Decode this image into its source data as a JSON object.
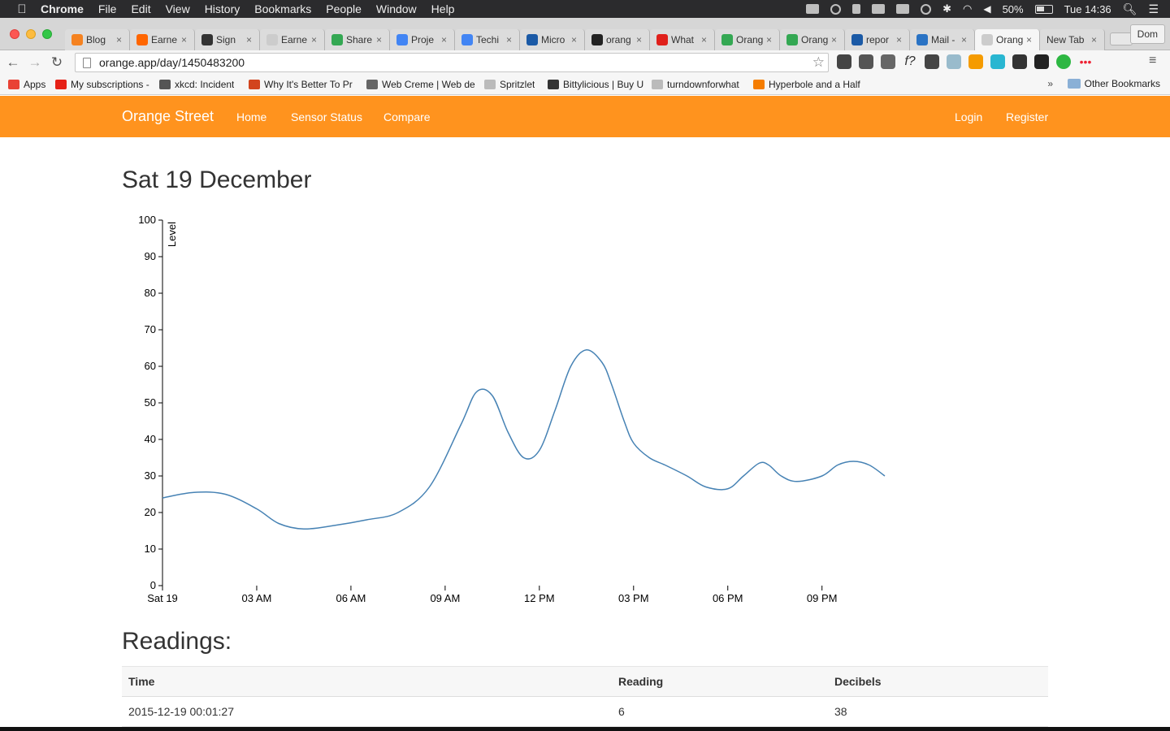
{
  "os_menubar": {
    "app": "Chrome",
    "items": [
      "File",
      "Edit",
      "View",
      "History",
      "Bookmarks",
      "People",
      "Window",
      "Help"
    ],
    "battery": "50%",
    "clock": "Tue 14:36"
  },
  "browser": {
    "tabs": [
      {
        "label": "Blog",
        "icon": "blogger",
        "color": "#f58220"
      },
      {
        "label": "Earne",
        "icon": "y-combinator",
        "color": "#ff6600"
      },
      {
        "label": "Sign",
        "icon": "pen",
        "color": "#333333"
      },
      {
        "label": "Earne",
        "icon": "page",
        "color": "#cccccc"
      },
      {
        "label": "Share",
        "icon": "drive",
        "color": "#34a853"
      },
      {
        "label": "Proje",
        "icon": "docs",
        "color": "#4285f4"
      },
      {
        "label": "Techi",
        "icon": "docs",
        "color": "#4285f4"
      },
      {
        "label": "Micro",
        "icon": "ke",
        "color": "#1b5aa6"
      },
      {
        "label": "orang",
        "icon": "github",
        "color": "#222222"
      },
      {
        "label": "What",
        "icon": "alert",
        "color": "#e0201b"
      },
      {
        "label": "Orang",
        "icon": "drive",
        "color": "#34a853"
      },
      {
        "label": "Orang",
        "icon": "drive",
        "color": "#34a853"
      },
      {
        "label": "repor",
        "icon": "ke",
        "color": "#1b5aa6"
      },
      {
        "label": "Mail -",
        "icon": "mail",
        "color": "#2a73c4"
      },
      {
        "label": "Orang",
        "icon": "page",
        "color": "#cccccc",
        "active": true
      },
      {
        "label": "New Tab",
        "icon": "none",
        "color": "transparent"
      }
    ],
    "profile": "Dom",
    "url": "orange.app/day/1450483200",
    "bookmarks": [
      {
        "label": "Apps",
        "color": "#e94235"
      },
      {
        "label": "My subscriptions - Yo",
        "color": "#e62117"
      },
      {
        "label": "xkcd: Incident",
        "color": "#555555"
      },
      {
        "label": "Why It's Better To Pr",
        "color": "#d2441e"
      },
      {
        "label": "Web Creme | Web de",
        "color": "#666666"
      },
      {
        "label": "Spritzlet",
        "color": "#bbbbbb"
      },
      {
        "label": "Bittylicious | Buy UK",
        "color": "#333333"
      },
      {
        "label": "turndownforwhat",
        "color": "#bbbbbb"
      },
      {
        "label": "Hyperbole and a Half",
        "color": "#f57d00"
      }
    ],
    "overflow": "»",
    "other_bookmarks": "Other Bookmarks"
  },
  "nav": {
    "brand": "Orange Street",
    "links": [
      "Home",
      "Sensor Status",
      "Compare"
    ],
    "right": [
      "Login",
      "Register"
    ],
    "color": "#ff931e"
  },
  "page": {
    "title": "Sat 19 December",
    "readings_title": "Readings:",
    "table": {
      "headers": [
        "Time",
        "Reading",
        "Decibels"
      ],
      "rows": [
        [
          "2015-12-19 00:01:27",
          "6",
          "38"
        ]
      ]
    }
  },
  "chart_data": {
    "type": "line",
    "title": "",
    "xlabel": "",
    "ylabel": "Level",
    "ylim": [
      0,
      100
    ],
    "yticks": [
      0,
      10,
      20,
      30,
      40,
      50,
      60,
      70,
      80,
      90,
      100
    ],
    "xticks": [
      "Sat 19",
      "03 AM",
      "06 AM",
      "09 AM",
      "12 PM",
      "03 PM",
      "06 PM",
      "09 PM"
    ],
    "xticks_hours": [
      0,
      3,
      6,
      9,
      12,
      15,
      18,
      21
    ],
    "xlim_hours": [
      0,
      23
    ],
    "line_color": "#4682b4",
    "series": [
      {
        "x": [
          0,
          1,
          2,
          3,
          3.7,
          4.5,
          5.5,
          6.5,
          7.5,
          8.5,
          9.5,
          10,
          10.5,
          11,
          11.5,
          12,
          12.5,
          13,
          13.5,
          14,
          14.3,
          14.7,
          15,
          15.5,
          16,
          16.7,
          17.3,
          18,
          18.5,
          19,
          19.3,
          19.7,
          20.2,
          21,
          21.5,
          22,
          22.5,
          23
        ],
        "values": [
          24,
          25.5,
          25,
          21,
          17,
          15.5,
          16.5,
          18,
          20,
          27,
          44,
          53,
          52,
          42,
          35,
          37,
          48,
          60,
          64.5,
          61,
          55,
          45,
          39,
          35,
          33,
          30,
          27,
          26.5,
          30,
          33.5,
          33,
          30,
          28.5,
          30,
          33,
          34,
          33,
          30
        ]
      }
    ]
  }
}
